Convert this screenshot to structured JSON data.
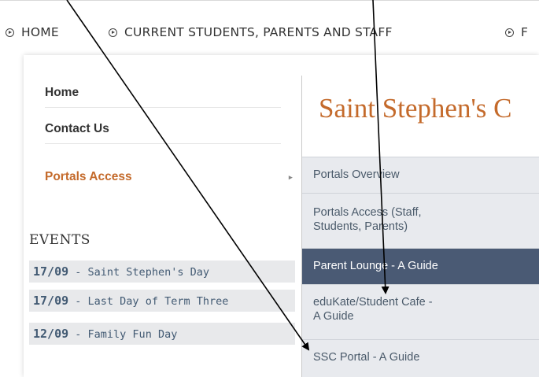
{
  "breadcrumb": [
    {
      "label": "HOME"
    },
    {
      "label": "CURRENT STUDENTS, PARENTS AND STAFF"
    },
    {
      "label": "F"
    }
  ],
  "left_nav": [
    {
      "label": "Home"
    },
    {
      "label": "Contact Us"
    },
    {
      "label": "Portals Access",
      "active": true
    }
  ],
  "page_title": "Saint Stephen's C",
  "events": {
    "title": "EVENTS",
    "items": [
      {
        "date": "17/09",
        "text": " - Saint Stephen's Day"
      },
      {
        "date": "17/09",
        "text": " - Last Day of Term Three"
      },
      {
        "date": "12/09",
        "text": " - Family Fun Day"
      }
    ]
  },
  "submenu": [
    {
      "label": "Portals Overview"
    },
    {
      "label": "Portals Access (Staff, Students, Parents)"
    },
    {
      "label": "Parent Lounge - A Guide",
      "active": true
    },
    {
      "label": "eduKate/Student Cafe - A Guide"
    },
    {
      "label": "SSC Portal - A Guide"
    }
  ],
  "colors": {
    "accent": "#c46a2b",
    "submenu_active": "#4a5a74",
    "submenu_bg": "#e8eaee",
    "event_bg": "#e8e9eb"
  }
}
